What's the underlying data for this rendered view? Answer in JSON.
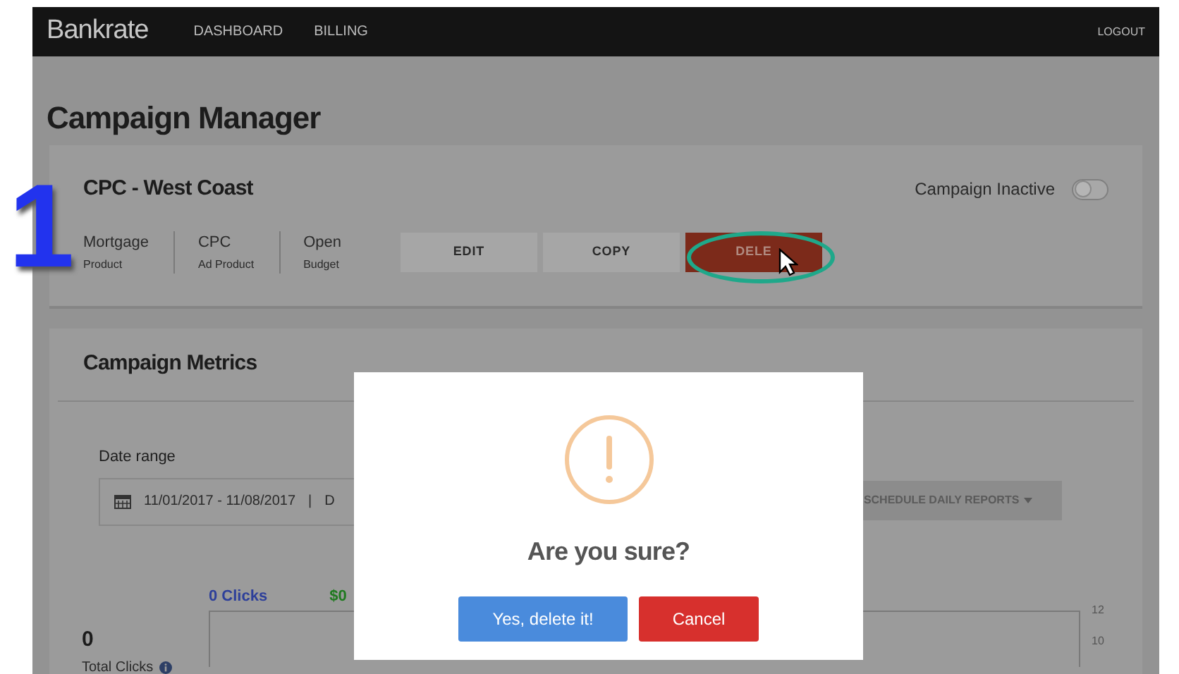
{
  "annotation": {
    "label": "1"
  },
  "nav": {
    "logo": "Bankrate",
    "items": [
      {
        "label": "DASHBOARD"
      },
      {
        "label": "BILLING"
      }
    ],
    "logout": "LOGOUT"
  },
  "page_title": "Campaign Manager",
  "campaign": {
    "name": "CPC - West Coast",
    "status_label": "Campaign Inactive",
    "on": false,
    "facts": [
      {
        "value": "Mortgage",
        "label": "Product"
      },
      {
        "value": "CPC",
        "label": "Ad Product"
      },
      {
        "value": "Open",
        "label": "Budget"
      }
    ],
    "actions": [
      {
        "label": "EDIT",
        "kind": "plain"
      },
      {
        "label": "COPY",
        "kind": "plain"
      },
      {
        "label": "DELE",
        "kind": "danger"
      }
    ]
  },
  "metrics": {
    "title": "Campaign Metrics",
    "date_range_label": "Date range",
    "date_range": "11/01/2017 - 11/08/2017",
    "separator": "|",
    "field_2": "D",
    "schedule_button": "SCHEDULE DAILY REPORTS",
    "legend": [
      {
        "label": "0 Clicks",
        "color": "#2d3f9a"
      },
      {
        "label": "$0",
        "color": "#1f7a1f"
      }
    ],
    "total_value": "0",
    "total_label": "Total Clicks",
    "y_ticks": [
      "12",
      "10"
    ]
  },
  "dialog": {
    "title": "Are you sure?",
    "confirm": "Yes, delete it!",
    "cancel": "Cancel"
  }
}
